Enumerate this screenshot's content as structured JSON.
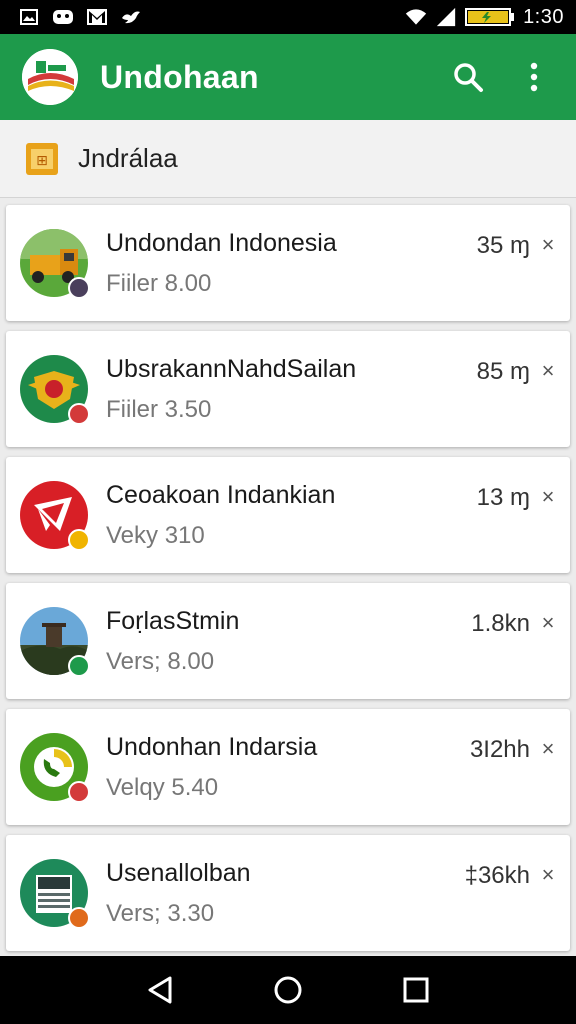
{
  "status_bar": {
    "time": "1:30",
    "icons": [
      "image-icon",
      "game-icon",
      "gmail-icon",
      "bird-icon",
      "wifi-icon",
      "signal-icon",
      "battery-icon"
    ]
  },
  "app_bar": {
    "title": "Undohaan",
    "accent_color": "#1e9a4b",
    "actions": [
      "search-icon",
      "more-vert-icon"
    ]
  },
  "breadcrumb": {
    "label": "Jndrálaa",
    "icon": "folder-app-icon"
  },
  "apps": [
    {
      "name": "Undondan Indonesia",
      "subtitle": "Fiiler 8.00",
      "size": "35 ɱ",
      "icon": "truck-icon",
      "badge_color": "#4a3f5c"
    },
    {
      "name": "UbsrakannNahdSailan",
      "subtitle": "Fiiler 3.50",
      "size": "85 ɱ",
      "icon": "emblem-icon",
      "badge_color": "#d33a3a"
    },
    {
      "name": "Ceoakoan Indankian",
      "subtitle": "Veky 310",
      "size": "13 ɱ",
      "icon": "arrow-send-icon",
      "badge_color": "#f0b400"
    },
    {
      "name": "FoṛlasStmin",
      "subtitle": "Vers; 8.00",
      "size": "1.8kn",
      "icon": "landmark-photo-icon",
      "badge_color": "#1e9a4b"
    },
    {
      "name": "Undonhan Indarsia",
      "subtitle": "Velqy 5.40",
      "size": "3I2hh",
      "icon": "phone-circle-icon",
      "badge_color": "#d33a3a"
    },
    {
      "name": "Usenallolban",
      "subtitle": "Vers; 3.30",
      "size": "‡36kh",
      "icon": "document-icon",
      "badge_color": "#e06a1b"
    }
  ],
  "close_glyph": "×",
  "nav_bar": [
    "back-icon",
    "home-icon",
    "recents-icon"
  ]
}
